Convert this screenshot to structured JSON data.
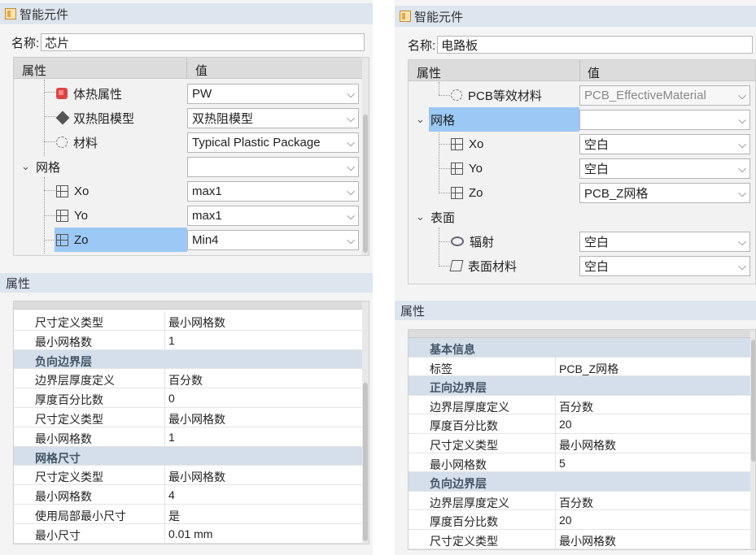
{
  "left": {
    "title": "智能元件",
    "name_label": "名称:",
    "name_value": "芯片",
    "grid_header": {
      "prop": "属性",
      "val": "值"
    },
    "rows": [
      {
        "label": "体热属性",
        "value": "PW",
        "icon": "cube-red-icon"
      },
      {
        "label": "双热阻模型",
        "value": "双热阻模型",
        "icon": "diamond-icon"
      },
      {
        "label": "材料",
        "value": "Typical Plastic Package",
        "icon": "material-sphere-icon"
      },
      {
        "label": "网格",
        "value": "",
        "icon": ""
      },
      {
        "label": "Xo",
        "value": "max1",
        "icon": "mesh-cube-icon"
      },
      {
        "label": "Yo",
        "value": "max1",
        "icon": "mesh-cube-icon"
      },
      {
        "label": "Zo",
        "value": "Min4",
        "icon": "mesh-cube-icon"
      }
    ],
    "prop_section": "属性",
    "props": [
      {
        "k": "尺寸定义类型",
        "v": "最小网格数"
      },
      {
        "k": "最小网格数",
        "v": "1"
      },
      {
        "k": "负向边界层",
        "v": "",
        "group": true
      },
      {
        "k": "边界层厚度定义",
        "v": "百分数"
      },
      {
        "k": "厚度百分比数",
        "v": "0"
      },
      {
        "k": "尺寸定义类型",
        "v": "最小网格数"
      },
      {
        "k": "最小网格数",
        "v": "1"
      },
      {
        "k": "网格尺寸",
        "v": "",
        "group": true
      },
      {
        "k": "尺寸定义类型",
        "v": "最小网格数"
      },
      {
        "k": "最小网格数",
        "v": "4"
      },
      {
        "k": "使用局部最小尺寸",
        "v": "是"
      },
      {
        "k": "最小尺寸",
        "v": "0.01 mm"
      }
    ]
  },
  "right": {
    "title": "智能元件",
    "name_label": "名称:",
    "name_value": "电路板",
    "grid_header": {
      "prop": "属性",
      "val": "值"
    },
    "rows": [
      {
        "label": "PCB等效材料",
        "value": "PCB_EffectiveMaterial",
        "icon": "material-sphere-icon"
      },
      {
        "label": "网格",
        "value": "",
        "icon": ""
      },
      {
        "label": "Xo",
        "value": "空白",
        "icon": "mesh-cube-icon"
      },
      {
        "label": "Yo",
        "value": "空白",
        "icon": "mesh-cube-icon"
      },
      {
        "label": "Zo",
        "value": "PCB_Z网格",
        "icon": "mesh-cube-icon"
      },
      {
        "label": "表面",
        "value": "",
        "icon": ""
      },
      {
        "label": "辐射",
        "value": "空白",
        "icon": "radiation-icon"
      },
      {
        "label": "表面材料",
        "value": "空白",
        "icon": "surface-material-icon"
      }
    ],
    "prop_section": "属性",
    "props": [
      {
        "k": "基本信息",
        "v": "",
        "group": true
      },
      {
        "k": "标签",
        "v": "PCB_Z网格"
      },
      {
        "k": "正向边界层",
        "v": "",
        "group": true
      },
      {
        "k": "边界层厚度定义",
        "v": "百分数"
      },
      {
        "k": "厚度百分比数",
        "v": "20"
      },
      {
        "k": "尺寸定义类型",
        "v": "最小网格数"
      },
      {
        "k": "最小网格数",
        "v": "5"
      },
      {
        "k": "负向边界层",
        "v": "",
        "group": true
      },
      {
        "k": "边界层厚度定义",
        "v": "百分数"
      },
      {
        "k": "厚度百分比数",
        "v": "20"
      },
      {
        "k": "尺寸定义类型",
        "v": "最小网格数"
      }
    ]
  }
}
